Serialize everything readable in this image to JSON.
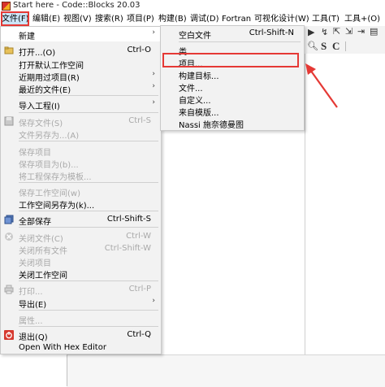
{
  "window": {
    "title": "Start here - Code::Blocks 20.03"
  },
  "menubar": {
    "items": [
      {
        "label": "文件(F)",
        "active": true
      },
      {
        "label": "编辑(E)"
      },
      {
        "label": "视图(V)"
      },
      {
        "label": "搜索(R)"
      },
      {
        "label": "项目(P)"
      },
      {
        "label": "构建(B)"
      },
      {
        "label": "调试(D)"
      },
      {
        "label": "Fortran"
      },
      {
        "label": "可视化设计(W)"
      },
      {
        "label": "工具(T)"
      },
      {
        "label": "工具+(O)"
      }
    ]
  },
  "toolbar": {
    "s_label": "S",
    "c_label": "C"
  },
  "file_menu": {
    "items": [
      {
        "label": "新建",
        "submenu": true
      },
      {
        "label": "打开...(O)",
        "shortcut": "Ctrl-O"
      },
      {
        "label": "打开默认工作空间"
      },
      {
        "label": "近期用过项目(R)",
        "submenu": true
      },
      {
        "label": "最近的文件(E)",
        "submenu": true
      },
      {
        "label": "导入工程(I)",
        "submenu": true
      },
      {
        "label": "保存文件(S)",
        "shortcut": "Ctrl-S",
        "disabled": true
      },
      {
        "label": "文件另存为...(A)",
        "disabled": true
      },
      {
        "label": "保存项目",
        "disabled": true
      },
      {
        "label": "保存项目为(b)...",
        "disabled": true
      },
      {
        "label": "将工程保存为模板...",
        "disabled": true
      },
      {
        "label": "保存工作空间(w)",
        "disabled": true
      },
      {
        "label": "工作空间另存为(k)..."
      },
      {
        "label": "全部保存",
        "shortcut": "Ctrl-Shift-S"
      },
      {
        "label": "关闭文件(C)",
        "shortcut": "Ctrl-W",
        "disabled": true
      },
      {
        "label": "关闭所有文件",
        "shortcut": "Ctrl-Shift-W",
        "disabled": true
      },
      {
        "label": "关闭项目",
        "disabled": true
      },
      {
        "label": "关闭工作空间"
      },
      {
        "label": "打印...",
        "shortcut": "Ctrl-P",
        "disabled": true
      },
      {
        "label": "导出(E)",
        "submenu": true
      },
      {
        "label": "属性...",
        "disabled": true
      },
      {
        "label": "退出(Q)",
        "shortcut": "Ctrl-Q"
      },
      {
        "label": "Open With Hex Editor"
      }
    ]
  },
  "new_submenu": {
    "items": [
      {
        "label": "空白文件",
        "shortcut": "Ctrl-Shift-N"
      },
      {
        "label": "类..."
      },
      {
        "label": "项目..."
      },
      {
        "label": "构建目标..."
      },
      {
        "label": "文件..."
      },
      {
        "label": "自定义..."
      },
      {
        "label": "来自模版..."
      },
      {
        "label": "Nassi 施奈德曼图"
      }
    ]
  },
  "colors": {
    "highlight": "#e53935",
    "menu_active": "#cce4f7"
  }
}
